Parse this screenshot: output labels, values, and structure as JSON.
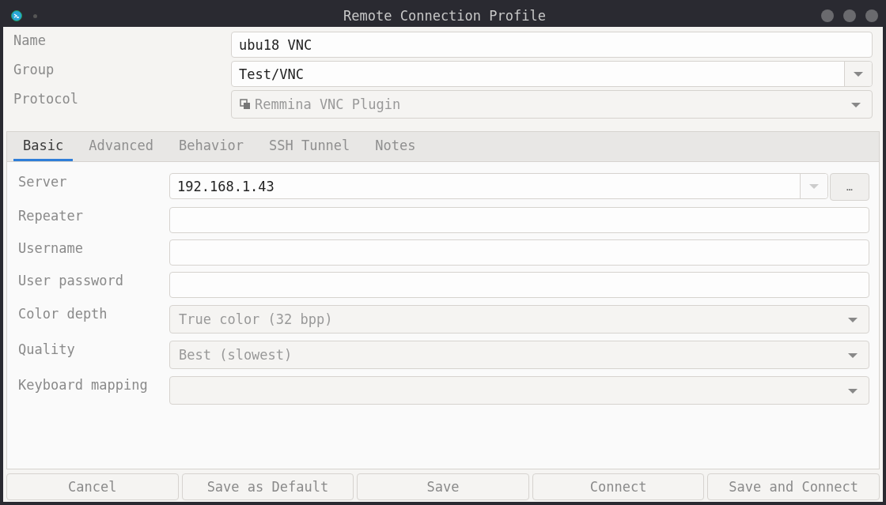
{
  "window": {
    "title": "Remote Connection Profile"
  },
  "profile": [
    {
      "label": "Name",
      "kind": "text",
      "value": "ubu18 VNC"
    },
    {
      "label": "Group",
      "kind": "combo",
      "value": "Test/VNC"
    },
    {
      "label": "Protocol",
      "kind": "select",
      "value": "Remmina VNC Plugin",
      "icon": true
    }
  ],
  "tabs": [
    {
      "label": "Basic",
      "selected": true
    },
    {
      "label": "Advanced",
      "selected": false
    },
    {
      "label": "Behavior",
      "selected": false
    },
    {
      "label": "SSH Tunnel",
      "selected": false
    },
    {
      "label": "Notes",
      "selected": false
    }
  ],
  "basic": [
    {
      "label": "Server",
      "kind": "combo",
      "value": "192.168.1.43",
      "button": "…"
    },
    {
      "label": "Repeater",
      "kind": "text"
    },
    {
      "label": "Username",
      "kind": "text"
    },
    {
      "label": "User password",
      "kind": "text"
    },
    {
      "label": "Color depth",
      "kind": "select",
      "value": "True color (32 bpp)"
    },
    {
      "label": "Quality",
      "kind": "select",
      "value": "Best (slowest)"
    },
    {
      "label": "Keyboard mapping",
      "kind": "select"
    }
  ],
  "buttons": [
    "Cancel",
    "Save as Default",
    "Save",
    "Connect",
    "Save and Connect"
  ]
}
